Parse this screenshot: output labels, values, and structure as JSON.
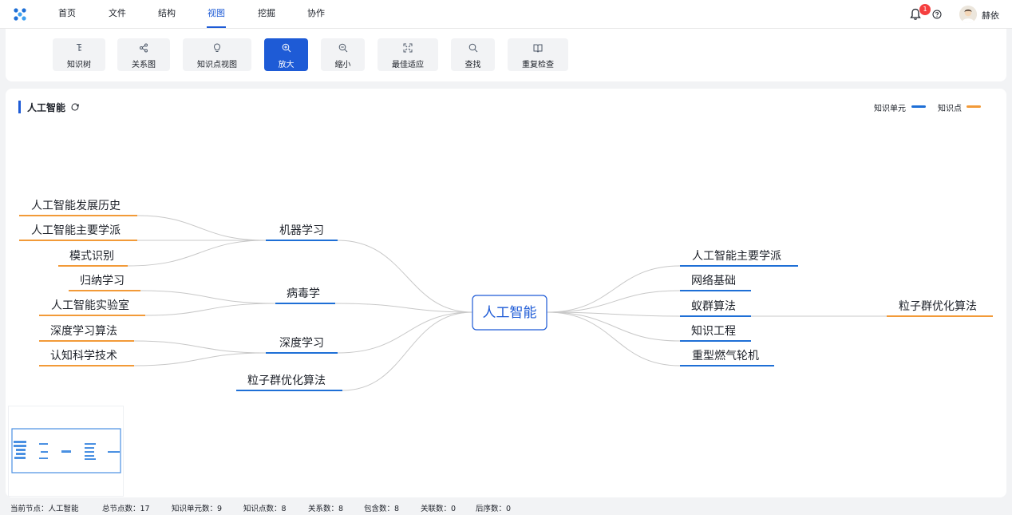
{
  "nav": {
    "items": [
      {
        "label": "首页"
      },
      {
        "label": "文件"
      },
      {
        "label": "结构"
      },
      {
        "label": "视图",
        "active": true
      },
      {
        "label": "挖掘"
      },
      {
        "label": "协作"
      }
    ],
    "notification_count": "1",
    "username": "赫依"
  },
  "toolbar": {
    "items": [
      {
        "label": "知识树",
        "icon": "tree-icon"
      },
      {
        "label": "关系图",
        "icon": "share-graph-icon"
      },
      {
        "label": "知识点视图",
        "icon": "bulb-icon"
      },
      {
        "label": "放大",
        "icon": "zoom-in-icon",
        "active": true
      },
      {
        "label": "缩小",
        "icon": "zoom-out-icon"
      },
      {
        "label": "最佳适应",
        "icon": "fit-icon"
      },
      {
        "label": "查找",
        "icon": "search-icon"
      },
      {
        "label": "重复检查",
        "icon": "book-check-icon"
      }
    ]
  },
  "main": {
    "title": "人工智能",
    "legend": [
      {
        "label": "知识单元",
        "color": "#1e6fd6"
      },
      {
        "label": "知识点",
        "color": "#f29a38"
      }
    ]
  },
  "mindmap": {
    "root": "人工智能",
    "left": [
      {
        "label": "机器学习",
        "children": [
          "人工智能发展历史",
          "人工智能主要学派",
          "模式识别"
        ]
      },
      {
        "label": "病毒学",
        "children": [
          "归纳学习",
          "人工智能实验室"
        ]
      },
      {
        "label": "深度学习",
        "children": [
          "深度学习算法",
          "认知科学技术"
        ]
      },
      {
        "label": "粒子群优化算法",
        "children": []
      }
    ],
    "right": [
      {
        "label": "人工智能主要学派",
        "children": []
      },
      {
        "label": "网络基础",
        "children": []
      },
      {
        "label": "蚁群算法",
        "children": [
          "粒子群优化算法"
        ]
      },
      {
        "label": "知识工程",
        "children": []
      },
      {
        "label": "重型燃气轮机",
        "children": []
      }
    ]
  },
  "status": {
    "current_node": "当前节点：人工智能",
    "total_nodes": "总节点数：17",
    "unit_count": "知识单元数：9",
    "point_count": "知识点数：8",
    "relation_count": "关系数：8",
    "contain_count": "包含数：8",
    "assoc_count": "关联数：0",
    "sequence_count": "后序数：0"
  },
  "colors": {
    "accent": "#1e5bd6",
    "unit_line": "#1e6fd6",
    "point_line": "#f29a38",
    "edge": "#c8c8c8"
  }
}
